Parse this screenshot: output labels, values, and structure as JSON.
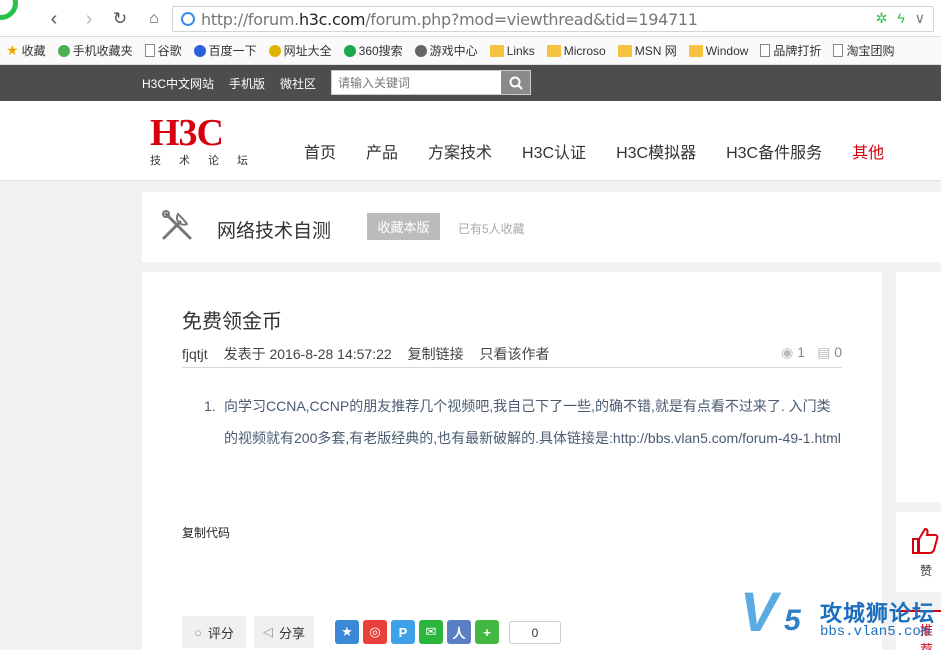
{
  "browser": {
    "url_prefix": "http://forum.",
    "url_domain": "h3c.com",
    "url_suffix": "/forum.php?mod=viewthread&tid=194711",
    "bookmarks": [
      {
        "label": "收藏",
        "icon": "star-icon"
      },
      {
        "label": "手机收藏夹",
        "icon": "phone-icon"
      },
      {
        "label": "谷歌",
        "icon": "page-icon"
      },
      {
        "label": "百度一下",
        "icon": "paw-icon"
      },
      {
        "label": "网址大全",
        "icon": "globe-icon"
      },
      {
        "label": "360搜索",
        "icon": "search-icon"
      },
      {
        "label": "游戏中心",
        "icon": "gamepad-icon"
      },
      {
        "label": "Links",
        "icon": "folder-icon"
      },
      {
        "label": "Microso",
        "icon": "folder-icon"
      },
      {
        "label": "MSN 网",
        "icon": "folder-icon"
      },
      {
        "label": "Window",
        "icon": "folder-icon"
      },
      {
        "label": "品牌打折",
        "icon": "page-icon"
      },
      {
        "label": "淘宝团购",
        "icon": "page-icon"
      }
    ]
  },
  "topbar": {
    "links": [
      "H3C中文网站",
      "手机版",
      "微社区"
    ],
    "search_placeholder": "请输入关键词"
  },
  "header": {
    "logo_text": "H3C",
    "logo_sub": "技术论坛",
    "nav": [
      {
        "label": "首页",
        "active": false
      },
      {
        "label": "产品",
        "active": false
      },
      {
        "label": "方案技术",
        "active": false
      },
      {
        "label": "H3C认证",
        "active": false
      },
      {
        "label": "H3C模拟器",
        "active": false
      },
      {
        "label": "H3C备件服务",
        "active": false
      },
      {
        "label": "其他",
        "active": true
      }
    ],
    "accent": "#d7000f"
  },
  "forum": {
    "title": "网络技术自测",
    "fav_button": "收藏本版",
    "fav_count": "已有5人收藏"
  },
  "post": {
    "title": "免费领金币",
    "author": "fjqtjt",
    "posted": "发表于 2016-8-28 14:57:22",
    "copy_link": "复制链接",
    "author_only": "只看该作者",
    "views": "1",
    "replies": "0",
    "item_number": "1.",
    "body": "向学习CCNA,CCNP的朋友推荐几个视频吧,我自己下了一些,的确不错,就是有点看不过来了. 入门类的视频就有200多套,有老版经典的,也有最新破解的.具体链接是:http://bbs.vlan5.com/forum-49-1.html",
    "copy_code": "复制代码",
    "rate": "评分",
    "share": "分享",
    "share_count": "0"
  },
  "side": {
    "like_label": "赞",
    "recommend_label": "推荐"
  },
  "watermark": {
    "cn": "攻城狮论坛",
    "url": "bbs.vlan5.com"
  }
}
